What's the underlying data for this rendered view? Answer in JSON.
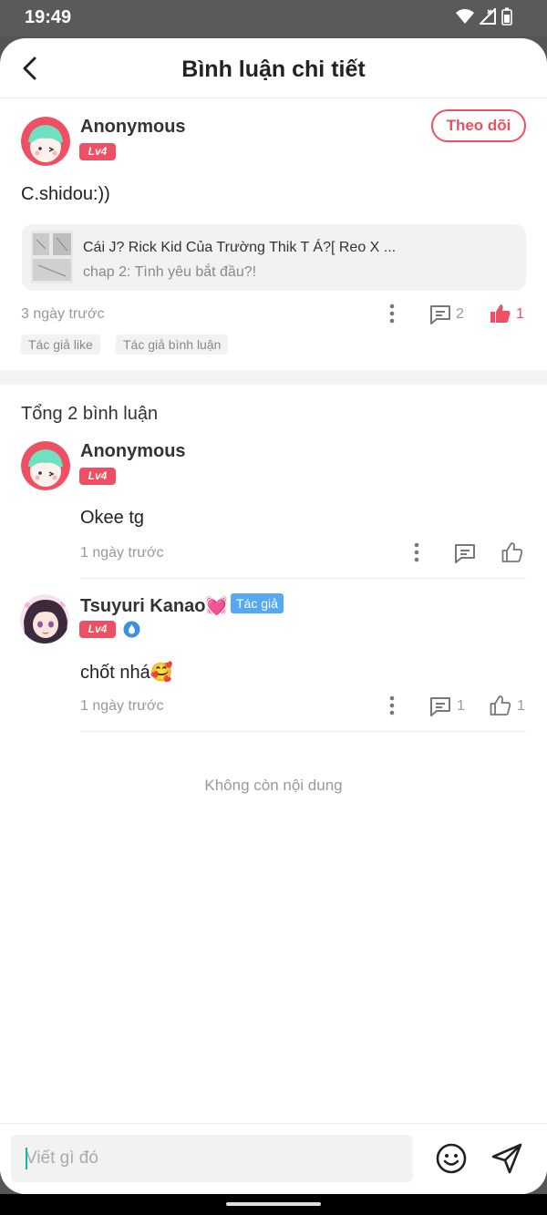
{
  "status_bar": {
    "time": "19:49"
  },
  "header": {
    "title": "Bình luận chi tiết"
  },
  "main_comment": {
    "user_name": "Anonymous",
    "level": "Lv4",
    "follow_label": "Theo dõi",
    "text": "C.shidou:))",
    "story": {
      "title": "Cái J? Rick Kid Của Trường Thik T Á?[ Reo X ...",
      "chapter": "chap 2: Tình yêu bắt đầu?!"
    },
    "time": "3 ngày trước",
    "reply_count": "2",
    "like_count": "1",
    "tags": [
      "Tác giả like",
      "Tác giả bình luận"
    ]
  },
  "replies_header": {
    "total": "Tổng 2 bình luận"
  },
  "replies": [
    {
      "user_name": "Anonymous",
      "level": "Lv4",
      "text": "Okee tg",
      "time": "1 ngày trước",
      "reply_count": "",
      "like_count": ""
    },
    {
      "user_name": "Tsuyuri Kanao💓",
      "author_badge": "Tác giả",
      "level": "Lv4",
      "text": "chốt nhá🥰",
      "time": "1 ngày trước",
      "reply_count": "1",
      "like_count": "1"
    }
  ],
  "footer_note": "Không còn nội dung",
  "composer": {
    "placeholder": "Viết gì đó"
  },
  "colors": {
    "accent": "#ef4f63",
    "author_badge": "#56a8f0",
    "caret": "#17b3a3"
  }
}
